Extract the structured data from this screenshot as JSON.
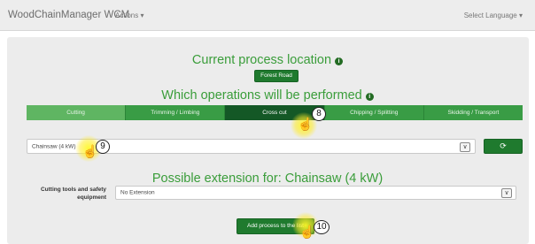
{
  "navbar": {
    "brand": "WoodChainManager WCM",
    "actions": "Actions ▾",
    "language": "Select Language ▾"
  },
  "location": {
    "title": "Current process location",
    "button": "Forest Road"
  },
  "operations": {
    "title": "Which operations will be performed",
    "tabs": [
      "Cutting",
      "Trimming / Limbing",
      "Cross cut",
      "Chipping / Splitting",
      "Skidding / Transport"
    ],
    "active_tab": "Cross cut"
  },
  "tool": {
    "value": "Chainsaw (4 kW)",
    "refresh_icon": "refresh-icon"
  },
  "extension": {
    "title": "Possible extension for: Chainsaw (4 kW)",
    "label": "Cutting tools and safety equipment",
    "value": "No Extension"
  },
  "add_button": "Add process to the list",
  "callouts": [
    "8",
    "9",
    "10"
  ],
  "colors": {
    "accent": "#3a9d3a",
    "dark_green": "#1f7a2e",
    "highlight": "#ffeb28"
  }
}
